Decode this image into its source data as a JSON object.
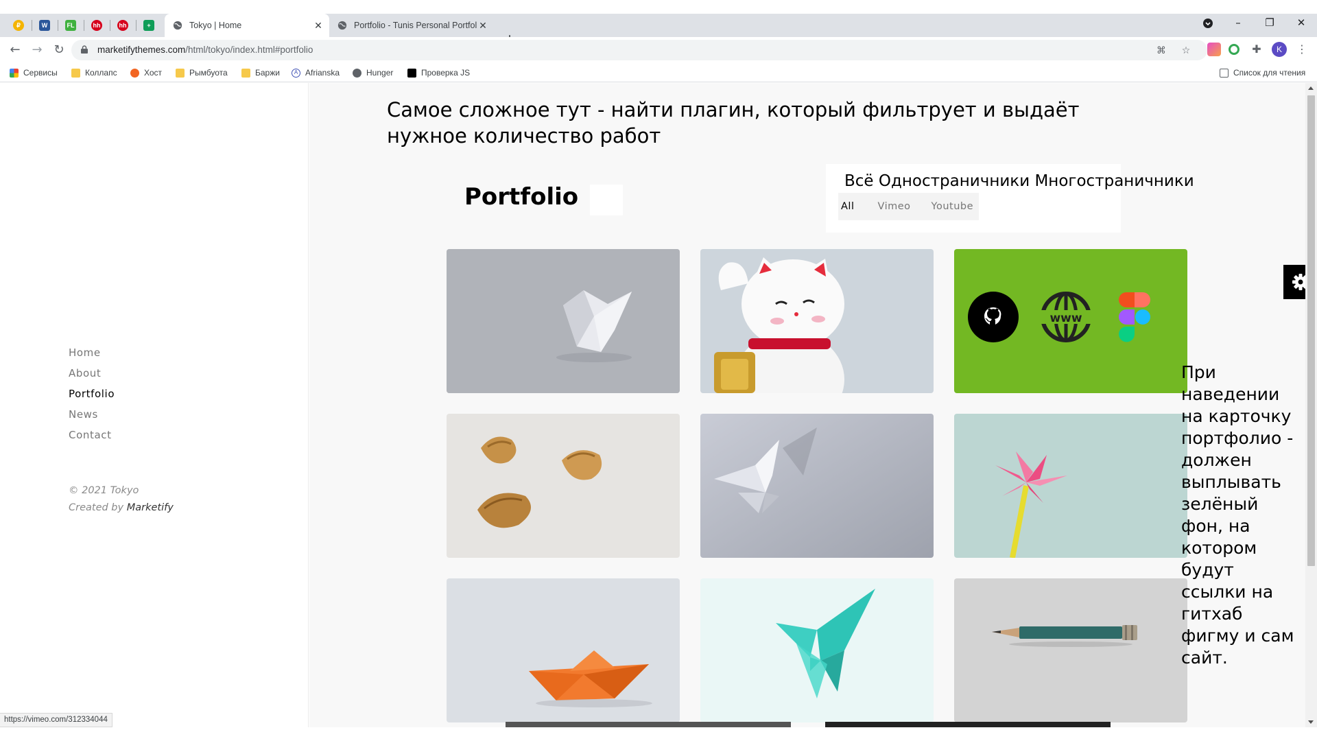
{
  "browser": {
    "tabs": [
      {
        "title": "Tokyo | Home",
        "active": true
      },
      {
        "title": "Portfolio - Tunis Personal Portfolio",
        "active": false
      }
    ],
    "pinned_tabs": [
      {
        "icon": "ruble-coin-icon",
        "label": "₽",
        "color": "#f4b400"
      },
      {
        "icon": "word-icon",
        "label": "W",
        "color": "#2b579a"
      },
      {
        "icon": "fl-icon",
        "label": "FL",
        "color": "#3fb13f"
      },
      {
        "icon": "hh-icon",
        "label": "hh",
        "color": "#d6001c"
      },
      {
        "icon": "hh-icon",
        "label": "hh",
        "color": "#d6001c"
      },
      {
        "icon": "sheets-icon",
        "label": "+",
        "color": "#0f9d58"
      }
    ],
    "url_host": "marketifythemes.com",
    "url_path": "/html/tokyo/index.html#portfolio",
    "bookmarks": [
      {
        "label": "Сервисы",
        "icon": "apps-grid-icon"
      },
      {
        "label": "Коллапс",
        "icon": "folder-icon"
      },
      {
        "label": "Хост",
        "icon": "host-icon"
      },
      {
        "label": "Рымбуота",
        "icon": "folder-icon"
      },
      {
        "label": "Баржи",
        "icon": "folder-icon"
      },
      {
        "label": "Afrianska",
        "icon": "letter-a-icon"
      },
      {
        "label": "Hunger",
        "icon": "globe-icon"
      },
      {
        "label": "Проверка JS",
        "icon": "js-icon"
      }
    ],
    "reading_list": "Список для чтения",
    "profile_initial": "K",
    "status_url": "https://vimeo.com/312334044"
  },
  "sidebar": {
    "nav": [
      {
        "label": "Home",
        "active": false
      },
      {
        "label": "About",
        "active": false
      },
      {
        "label": "Portfolio",
        "active": true
      },
      {
        "label": "News",
        "active": false
      },
      {
        "label": "Contact",
        "active": false
      }
    ],
    "copyright": "© 2021 Tokyo",
    "created_by_prefix": "Created by",
    "created_by_name": "Marketify"
  },
  "main": {
    "note_title": "Самое сложное тут - найти плагин, который фильтрует и выдаёт нужное количество работ",
    "portfolio_heading": "Portfolio",
    "categories_text": "Всё Одностраничники Многостраничники",
    "filters": [
      {
        "label": "All",
        "active": true
      },
      {
        "label": "Vimeo",
        "active": false
      },
      {
        "label": "Youtube",
        "active": false
      }
    ],
    "hover_note": "При наведении на карточку портфолио - должен выплывать зелёный фон, на котором будут ссылки на гитхаб фигму и сам сайт.",
    "cards": [
      {
        "name": "card-origami-white-box",
        "subject": "white origami box"
      },
      {
        "name": "card-lucky-cat",
        "subject": "lucky cat figurine"
      },
      {
        "name": "card-links-hover",
        "subject": "green hover with links",
        "links": [
          "github-icon",
          "www-icon",
          "figma-icon"
        ],
        "color": "#73b823"
      },
      {
        "name": "card-fortune-cookies",
        "subject": "fortune cookies"
      },
      {
        "name": "card-paper-butterfly",
        "subject": "white paper butterfly"
      },
      {
        "name": "card-pink-lily",
        "subject": "pink origami lily"
      },
      {
        "name": "card-paper-boat",
        "subject": "orange paper boat"
      },
      {
        "name": "card-teal-butterfly",
        "subject": "teal origami butterfly"
      },
      {
        "name": "card-pencil",
        "subject": "pencil"
      }
    ]
  }
}
